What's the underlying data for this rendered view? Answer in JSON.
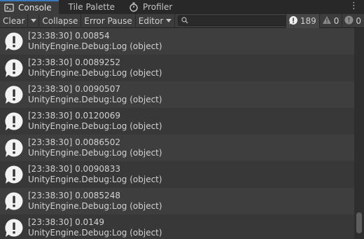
{
  "tabs": [
    {
      "label": "Console",
      "icon": "console-icon",
      "active": true
    },
    {
      "label": "Tile Palette",
      "active": false
    },
    {
      "label": "Profiler",
      "icon": "stopwatch-icon",
      "active": false
    }
  ],
  "toolbar": {
    "clear_label": "Clear",
    "collapse_label": "Collapse",
    "error_pause_label": "Error Pause",
    "editor_label": "Editor",
    "search": {
      "value": "",
      "placeholder": ""
    },
    "counts": {
      "info": "189",
      "warning": "0",
      "error": "0"
    }
  },
  "logs": [
    {
      "line1": "[23:38:30] 0.00854",
      "line2": "UnityEngine.Debug:Log (object)"
    },
    {
      "line1": "[23:38:30] 0.0089252",
      "line2": "UnityEngine.Debug:Log (object)"
    },
    {
      "line1": "[23:38:30] 0.0090507",
      "line2": "UnityEngine.Debug:Log (object)"
    },
    {
      "line1": "[23:38:30] 0.0120069",
      "line2": "UnityEngine.Debug:Log (object)"
    },
    {
      "line1": "[23:38:30] 0.0086502",
      "line2": "UnityEngine.Debug:Log (object)"
    },
    {
      "line1": "[23:38:30] 0.0090833",
      "line2": "UnityEngine.Debug:Log (object)"
    },
    {
      "line1": "[23:38:30] 0.0085248",
      "line2": "UnityEngine.Debug:Log (object)"
    },
    {
      "line1": "[23:38:30] 0.0149",
      "line2": "UnityEngine.Debug:Log (object)"
    }
  ],
  "colors": {
    "accent": "#3a79bb",
    "background": "#383838",
    "row_alt": "#3e3e3e",
    "text": "#d2d2d2"
  }
}
